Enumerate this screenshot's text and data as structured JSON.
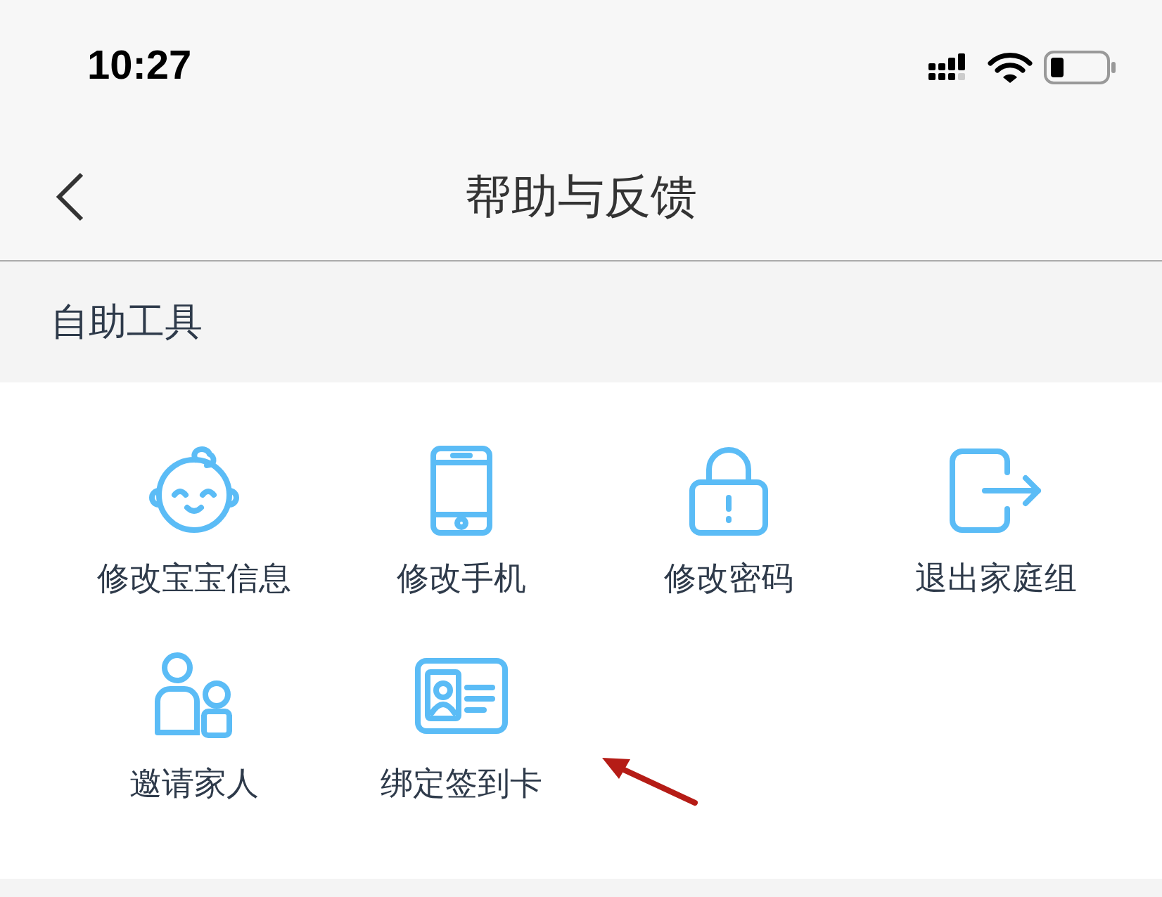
{
  "status_bar": {
    "time": "10:27"
  },
  "nav": {
    "title": "帮助与反馈"
  },
  "section": {
    "title": "自助工具"
  },
  "tools": [
    {
      "kind": "baby",
      "label": "修改宝宝信息"
    },
    {
      "kind": "phone",
      "label": "修改手机"
    },
    {
      "kind": "lock",
      "label": "修改密码"
    },
    {
      "kind": "exit",
      "label": "退出家庭组"
    },
    {
      "kind": "people",
      "label": "邀请家人"
    },
    {
      "kind": "card",
      "label": "绑定签到卡"
    }
  ]
}
